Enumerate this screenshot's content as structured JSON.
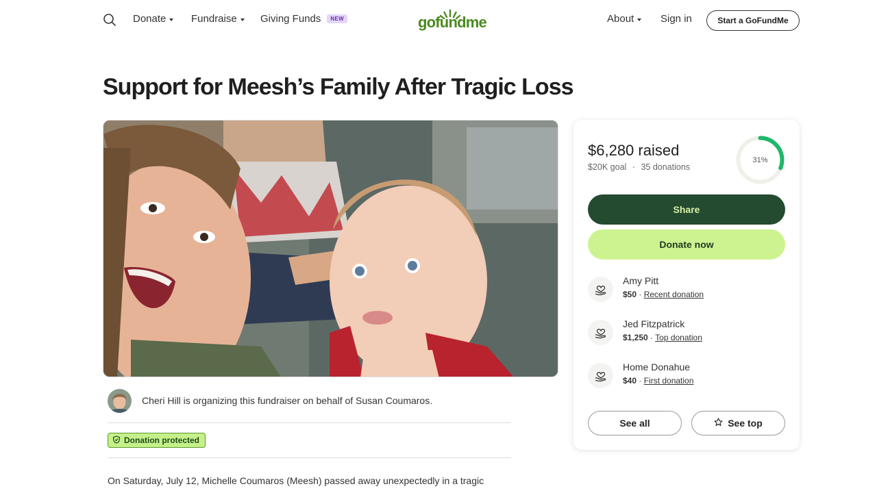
{
  "header": {
    "nav_left": [
      {
        "label": "Donate",
        "has_caret": true
      },
      {
        "label": "Fundraise",
        "has_caret": true
      },
      {
        "label": "Giving Funds",
        "badge": "NEW"
      }
    ],
    "logo_text": "gofundme",
    "nav_right": [
      {
        "label": "About",
        "has_caret": true
      },
      {
        "label": "Sign in"
      }
    ],
    "start_button": "Start a GoFundMe",
    "icons": {
      "search": "search-icon",
      "logo": "gofundme-logo"
    }
  },
  "page": {
    "title": "Support for Meesh’s Family After Tragic Loss"
  },
  "organizer": {
    "text": "Cheri Hill is organizing this fundraiser on behalf of Susan Coumaros."
  },
  "protection_badge": "Donation protected",
  "story": {
    "first_line": "On Saturday, July 12, Michelle Coumaros (Meesh) passed away unexpectedly in a tragic"
  },
  "donation": {
    "raised": "$6,280 raised",
    "goal": "$20K goal",
    "separator": "·",
    "count": "35 donations",
    "progress_label": "31%",
    "progress_fraction": 0.31,
    "share_label": "Share",
    "donate_label": "Donate now",
    "donors": [
      {
        "name": "Amy Pitt",
        "amount": "$50",
        "tag": "Recent donation"
      },
      {
        "name": "Jed Fitzpatrick",
        "amount": "$1,250",
        "tag": "Top donation"
      },
      {
        "name": "Home Donahue",
        "amount": "$40",
        "tag": "First donation"
      }
    ],
    "see_all_label": "See all",
    "see_top_label": "See top"
  },
  "colors": {
    "brand_green": "#4a8a1f",
    "share_bg": "#244a30",
    "donate_bg": "#cdf391",
    "progress": "#1fb86b",
    "badge_bg": "#c5f08a"
  }
}
